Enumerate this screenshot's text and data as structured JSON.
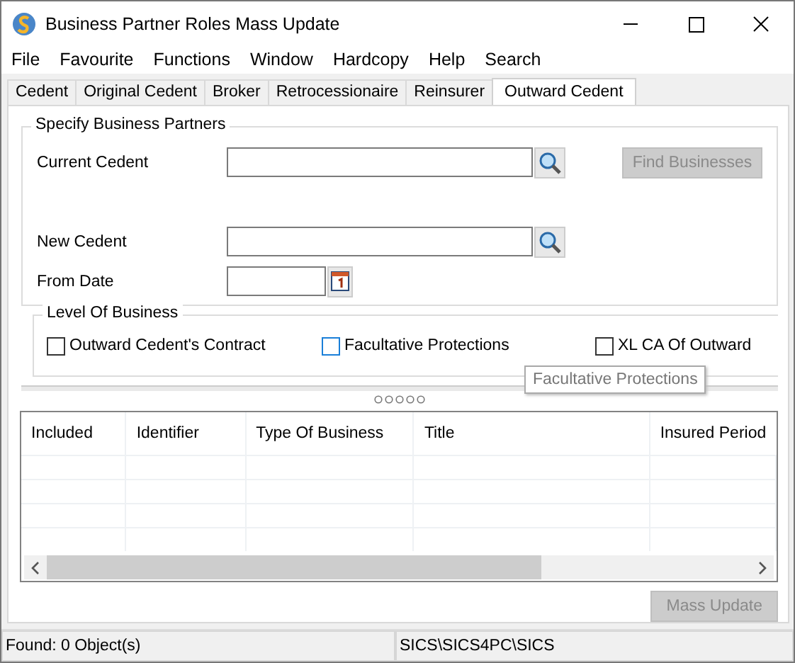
{
  "window": {
    "title": "Business Partner Roles Mass Update"
  },
  "menu": [
    "File",
    "Favourite",
    "Functions",
    "Window",
    "Hardcopy",
    "Help",
    "Search"
  ],
  "tabs": [
    {
      "label": "Cedent",
      "selected": false
    },
    {
      "label": "Original Cedent",
      "selected": false
    },
    {
      "label": "Broker",
      "selected": false
    },
    {
      "label": "Retrocessionaire",
      "selected": false
    },
    {
      "label": "Reinsurer",
      "selected": false
    },
    {
      "label": "Outward Cedent",
      "selected": true
    }
  ],
  "partners": {
    "title": "Specify Business Partners",
    "current_cedent": {
      "label": "Current Cedent"
    },
    "find_button": {
      "label": "Find Businesses",
      "disabled": true
    },
    "new_cedent": {
      "label": "New Cedent"
    },
    "from_date": {
      "label": "From Date"
    }
  },
  "level_of_business": {
    "title": "Level Of Business",
    "options": [
      {
        "label": "Outward Cedent's Contract",
        "checked": false,
        "focused": false
      },
      {
        "label": "Facultative Protections",
        "checked": false,
        "focused": true
      },
      {
        "label": "XL CA Of Outward",
        "checked": false,
        "focused": false
      }
    ]
  },
  "tooltip": "Facultative Protections",
  "table": {
    "columns": [
      "Included",
      "Identifier",
      "Type Of Business",
      "Title",
      "Insured Period"
    ]
  },
  "mass_update_button": {
    "label": "Mass Update",
    "disabled": true
  },
  "status_bar": [
    "Found: 0 Object(s)",
    "SICS\\SICS4PC\\SICS"
  ]
}
